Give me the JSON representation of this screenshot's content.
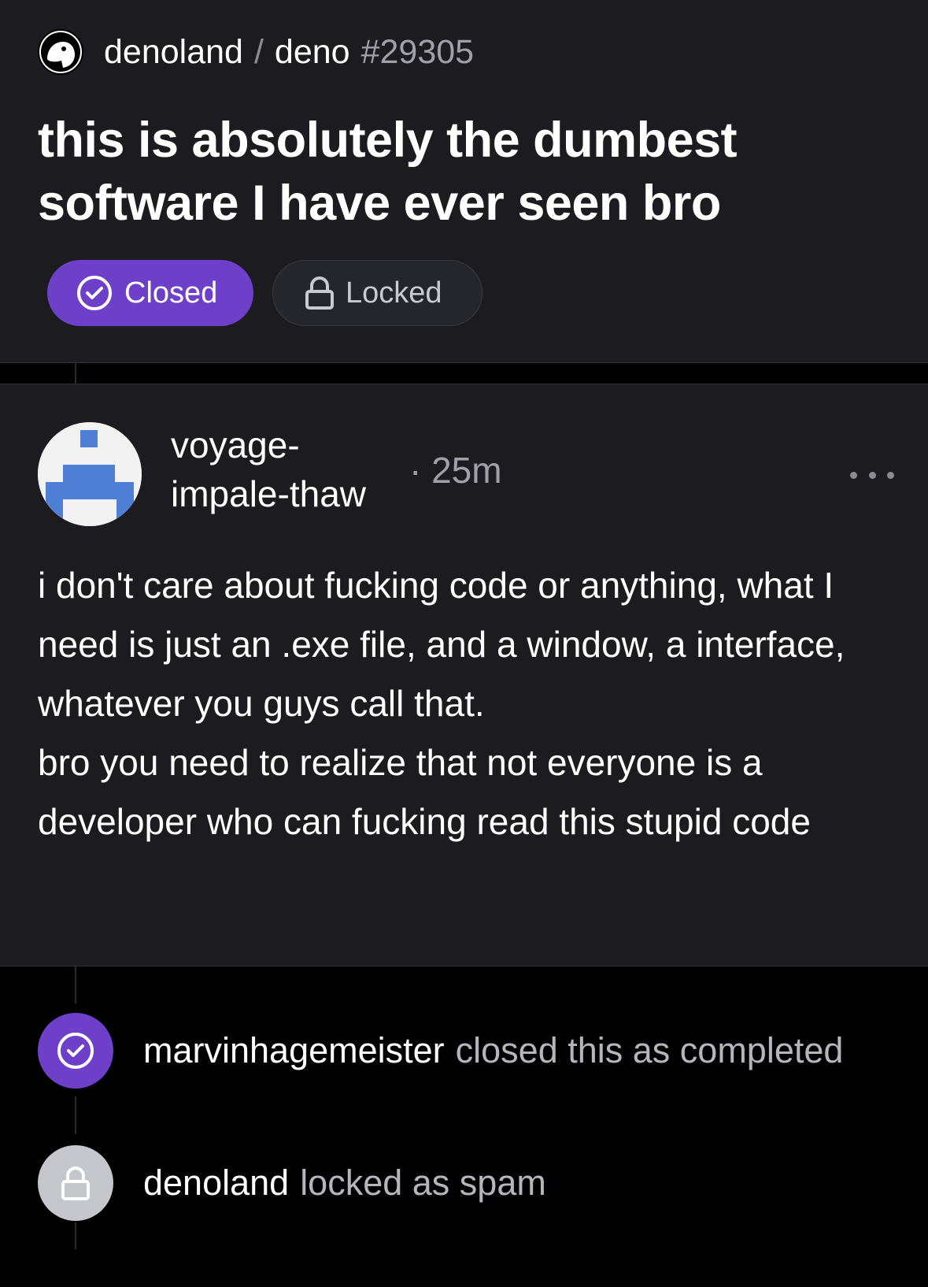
{
  "header": {
    "owner": "denoland",
    "separator": "/",
    "repo": "deno",
    "issue_number": "#29305",
    "title": "this is absolutely the dumbest software I have ever seen bro",
    "status_closed_label": "Closed",
    "status_locked_label": "Locked",
    "avatar_icon": "deno-logo-icon",
    "closed_icon": "check-circle-icon",
    "locked_icon": "lock-icon"
  },
  "comment": {
    "author_line1": "voyage-",
    "author_line2": "impale-thaw",
    "time": "· 25m",
    "more_icon": "ellipsis-icon",
    "body_lines": [
      "i don't care about fucking code or anything, what I need is just an .exe file, and a window, a interface, whatever you guys call that.",
      "bro you need to realize that not everyone is a developer who can fucking read this stupid code"
    ]
  },
  "events": [
    {
      "actor": "marvinhagemeister",
      "action": "closed this as completed",
      "icon": "check-circle-icon"
    },
    {
      "actor": "denoland",
      "action": "locked as spam",
      "icon": "lock-icon"
    }
  ],
  "colors": {
    "accent_purple": "#6e40c9",
    "card_bg": "#1c1c20",
    "page_bg": "#000000",
    "avatar_blue": "#4f7fd4"
  }
}
